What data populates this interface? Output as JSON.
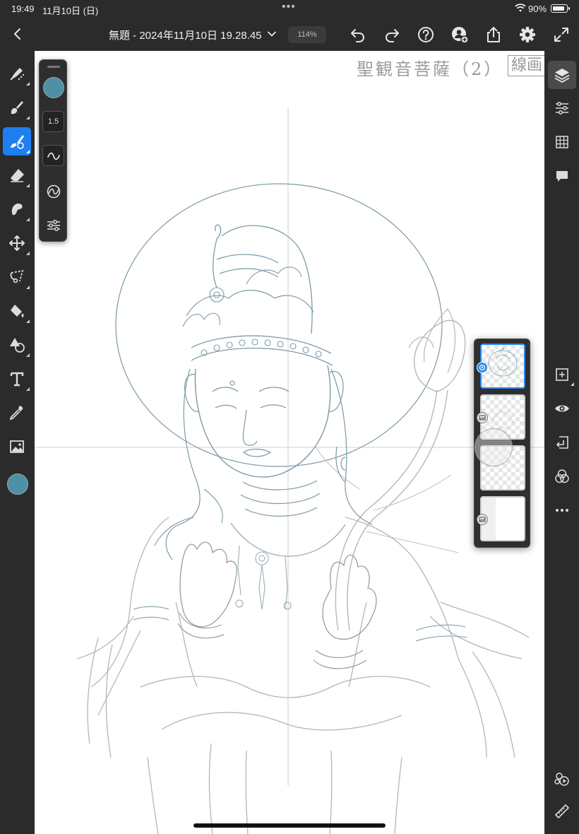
{
  "status_bar": {
    "time": "19:49",
    "date": "11月10日 (日)",
    "battery": "90%",
    "battery_level": 0.9
  },
  "toolbar": {
    "document_title": "無題 - 2024年11月10日 19.28.45",
    "zoom": "114%"
  },
  "brush_panel": {
    "size_value": "1.5"
  },
  "canvas": {
    "document_title": "聖観音菩薩（2）",
    "stamp_text": "線画"
  },
  "colors": {
    "accent": "#1e7ff0",
    "active_color": "#4e90a6",
    "line_art": "#7b9aa6",
    "panel_bg": "#2b2b2b"
  },
  "icons": {
    "left_tools": [
      "paint-brush-icon",
      "pixel-brush-icon",
      "live-brush-icon",
      "eraser-icon",
      "smudge-icon",
      "move-icon",
      "lasso-icon",
      "fill-icon",
      "shape-icon",
      "text-icon",
      "eyedropper-icon",
      "image-icon"
    ],
    "right_rail": [
      "layers-icon",
      "layer-properties-icon",
      "grid-icon",
      "comments-icon",
      "add-layer-icon",
      "visibility-icon",
      "merge-down-icon",
      "blend-mode-icon",
      "more-icon",
      "timelapse-icon",
      "ruler-icon"
    ]
  }
}
